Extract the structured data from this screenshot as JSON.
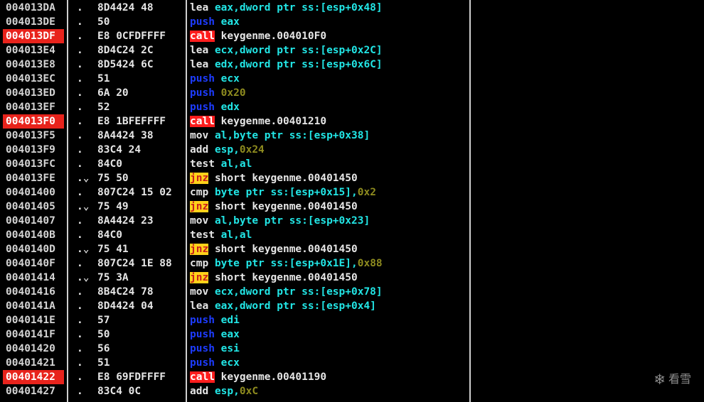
{
  "watermark": {
    "icon": "snowflake-icon",
    "text": "看雪"
  },
  "rows": [
    {
      "addr": "004013DA",
      "mark": ".",
      "hex": "8D4424 48",
      "mn": "lea",
      "mn_style": "plain",
      "ops": [
        {
          "t": "eax,dword ptr ss:[esp+0x48]",
          "k": "reg"
        }
      ]
    },
    {
      "addr": "004013DE",
      "mark": ".",
      "hex": "50",
      "mn": "push",
      "mn_style": "blue",
      "ops": [
        {
          "t": "eax",
          "k": "reg"
        }
      ]
    },
    {
      "addr": "004013DF",
      "addr_hl": true,
      "mark": ".",
      "hex": "E8 0CFDFFFF",
      "mn": "call",
      "mn_style": "call",
      "ops": [
        {
          "t": "keygenme.004010F0",
          "k": "tgt"
        }
      ]
    },
    {
      "addr": "004013E4",
      "mark": ".",
      "hex": "8D4C24 2C",
      "mn": "lea",
      "mn_style": "plain",
      "ops": [
        {
          "t": "ecx,dword ptr ss:[esp+0x2C]",
          "k": "reg"
        }
      ]
    },
    {
      "addr": "004013E8",
      "mark": ".",
      "hex": "8D5424 6C",
      "mn": "lea",
      "mn_style": "plain",
      "ops": [
        {
          "t": "edx,dword ptr ss:[esp+0x6C]",
          "k": "reg"
        }
      ]
    },
    {
      "addr": "004013EC",
      "mark": ".",
      "hex": "51",
      "mn": "push",
      "mn_style": "blue",
      "ops": [
        {
          "t": "ecx",
          "k": "reg"
        }
      ]
    },
    {
      "addr": "004013ED",
      "mark": ".",
      "hex": "6A 20",
      "mn": "push",
      "mn_style": "blue",
      "ops": [
        {
          "t": "0x20",
          "k": "num"
        }
      ]
    },
    {
      "addr": "004013EF",
      "mark": ".",
      "hex": "52",
      "mn": "push",
      "mn_style": "blue",
      "ops": [
        {
          "t": "edx",
          "k": "reg"
        }
      ]
    },
    {
      "addr": "004013F0",
      "addr_hl": true,
      "mark": ".",
      "hex": "E8 1BFEFFFF",
      "mn": "call",
      "mn_style": "call",
      "ops": [
        {
          "t": "keygenme.00401210",
          "k": "tgt"
        }
      ]
    },
    {
      "addr": "004013F5",
      "mark": ".",
      "hex": "8A4424 38",
      "mn": "mov",
      "mn_style": "plain",
      "ops": [
        {
          "t": "al,byte ptr ss:[esp+0x38]",
          "k": "reg"
        }
      ]
    },
    {
      "addr": "004013F9",
      "mark": ".",
      "hex": "83C4 24",
      "mn": "add",
      "mn_style": "plain",
      "ops": [
        {
          "t": "esp,",
          "k": "reg"
        },
        {
          "t": "0x24",
          "k": "num"
        }
      ]
    },
    {
      "addr": "004013FC",
      "mark": ".",
      "hex": "84C0",
      "mn": "test",
      "mn_style": "plain",
      "ops": [
        {
          "t": "al,al",
          "k": "reg"
        }
      ]
    },
    {
      "addr": "004013FE",
      "mark": ".⌄",
      "hex": "75 50",
      "mn": "jnz",
      "mn_style": "jnz",
      "ops": [
        {
          "t": "short keygenme.00401450",
          "k": "tgt"
        }
      ]
    },
    {
      "addr": "00401400",
      "mark": ".",
      "hex": "807C24 15 02",
      "mn": "cmp",
      "mn_style": "plain",
      "ops": [
        {
          "t": "byte ptr ss:[esp+0x15],",
          "k": "reg"
        },
        {
          "t": "0x2",
          "k": "num"
        }
      ]
    },
    {
      "addr": "00401405",
      "mark": ".⌄",
      "hex": "75 49",
      "mn": "jnz",
      "mn_style": "jnz",
      "ops": [
        {
          "t": "short keygenme.00401450",
          "k": "tgt"
        }
      ]
    },
    {
      "addr": "00401407",
      "mark": ".",
      "hex": "8A4424 23",
      "mn": "mov",
      "mn_style": "plain",
      "ops": [
        {
          "t": "al,byte ptr ss:[esp+0x23]",
          "k": "reg"
        }
      ]
    },
    {
      "addr": "0040140B",
      "mark": ".",
      "hex": "84C0",
      "mn": "test",
      "mn_style": "plain",
      "ops": [
        {
          "t": "al,al",
          "k": "reg"
        }
      ]
    },
    {
      "addr": "0040140D",
      "mark": ".⌄",
      "hex": "75 41",
      "mn": "jnz",
      "mn_style": "jnz",
      "ops": [
        {
          "t": "short keygenme.00401450",
          "k": "tgt"
        }
      ]
    },
    {
      "addr": "0040140F",
      "mark": ".",
      "hex": "807C24 1E 88",
      "mn": "cmp",
      "mn_style": "plain",
      "ops": [
        {
          "t": "byte ptr ss:[esp+0x1E],",
          "k": "reg"
        },
        {
          "t": "0x88",
          "k": "num"
        }
      ]
    },
    {
      "addr": "00401414",
      "mark": ".⌄",
      "hex": "75 3A",
      "mn": "jnz",
      "mn_style": "jnz",
      "ops": [
        {
          "t": "short keygenme.00401450",
          "k": "tgt"
        }
      ]
    },
    {
      "addr": "00401416",
      "mark": ".",
      "hex": "8B4C24 78",
      "mn": "mov",
      "mn_style": "plain",
      "ops": [
        {
          "t": "ecx,dword ptr ss:[esp+0x78]",
          "k": "reg"
        }
      ]
    },
    {
      "addr": "0040141A",
      "mark": ".",
      "hex": "8D4424 04",
      "mn": "lea",
      "mn_style": "plain",
      "ops": [
        {
          "t": "eax,dword ptr ss:[esp+0x4]",
          "k": "reg"
        }
      ]
    },
    {
      "addr": "0040141E",
      "mark": ".",
      "hex": "57",
      "mn": "push",
      "mn_style": "blue",
      "ops": [
        {
          "t": "edi",
          "k": "reg"
        }
      ]
    },
    {
      "addr": "0040141F",
      "mark": ".",
      "hex": "50",
      "mn": "push",
      "mn_style": "blue",
      "ops": [
        {
          "t": "eax",
          "k": "reg"
        }
      ]
    },
    {
      "addr": "00401420",
      "mark": ".",
      "hex": "56",
      "mn": "push",
      "mn_style": "blue",
      "ops": [
        {
          "t": "esi",
          "k": "reg"
        }
      ]
    },
    {
      "addr": "00401421",
      "mark": ".",
      "hex": "51",
      "mn": "push",
      "mn_style": "blue",
      "ops": [
        {
          "t": "ecx",
          "k": "reg"
        }
      ]
    },
    {
      "addr": "00401422",
      "addr_hl": true,
      "mark": ".",
      "hex": "E8 69FDFFFF",
      "mn": "call",
      "mn_style": "call",
      "ops": [
        {
          "t": "keygenme.00401190",
          "k": "tgt"
        }
      ]
    },
    {
      "addr": "00401427",
      "mark": ".",
      "hex": "83C4 0C",
      "mn": "add",
      "mn_style": "plain",
      "ops": [
        {
          "t": "esp,",
          "k": "reg"
        },
        {
          "t": "0xC",
          "k": "num"
        }
      ]
    }
  ]
}
